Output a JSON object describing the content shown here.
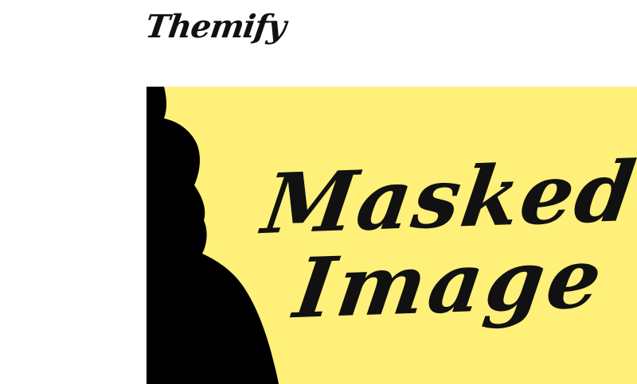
{
  "header": {
    "logo_text": "Themify"
  },
  "hero": {
    "line_1": "Masked",
    "line_2": "Image",
    "background_color": "#fff07a",
    "silhouette_color": "#000000",
    "text_color": "#111111"
  }
}
